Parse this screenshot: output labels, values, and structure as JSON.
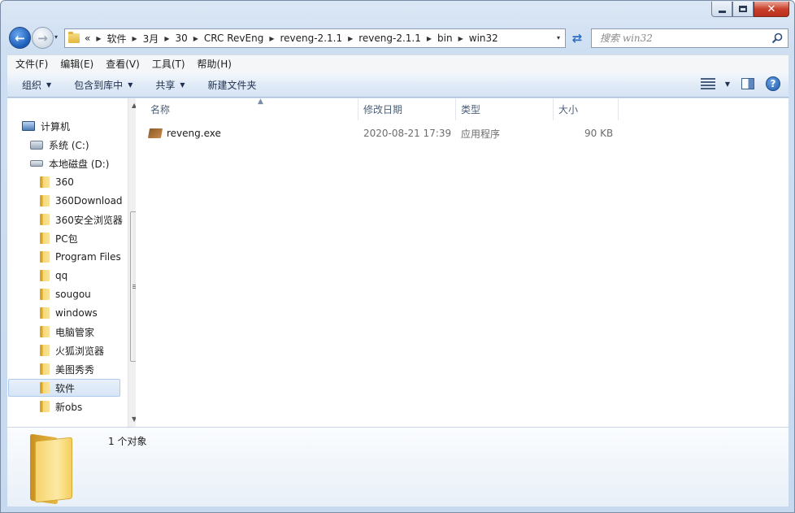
{
  "window": {
    "caption_minimize": "",
    "caption_maximize": "",
    "caption_close": "✕"
  },
  "nav": {
    "back_glyph": "←",
    "forward_glyph": "→",
    "dropdown_glyph": "▾"
  },
  "address": {
    "overflow": "«",
    "crumbs": [
      "软件",
      "3月",
      "30",
      "CRC RevEng",
      "reveng-2.1.1",
      "reveng-2.1.1",
      "bin",
      "win32"
    ],
    "refresh_glyph": "⇄"
  },
  "search": {
    "placeholder": "搜索 win32"
  },
  "menu": [
    "文件(F)",
    "编辑(E)",
    "查看(V)",
    "工具(T)",
    "帮助(H)"
  ],
  "commands": {
    "organize": "组织",
    "include_in_library": "包含到库中",
    "share": "共享",
    "new_folder": "新建文件夹",
    "help": "?"
  },
  "tree": {
    "computer": "计算机",
    "drive_c": "系统 (C:)",
    "drive_d": "本地磁盘 (D:)",
    "folders": [
      "360",
      "360Download",
      "360安全浏览器",
      "PC包",
      "Program Files",
      "qq",
      "sougou",
      "windows",
      "电脑管家",
      "火狐浏览器",
      "美图秀秀",
      "软件",
      "新obs"
    ],
    "selected": "软件"
  },
  "columns": {
    "name": "名称",
    "modified": "修改日期",
    "type": "类型",
    "size": "大小"
  },
  "files": [
    {
      "name": "reveng.exe",
      "modified": "2020-08-21 17:39",
      "type": "应用程序",
      "size": "90 KB"
    }
  ],
  "details": {
    "count": "1 个对象"
  },
  "colors": {
    "accent": "#1b5bb8",
    "selection": "#d6e5f6",
    "close_button": "#c9412c"
  }
}
